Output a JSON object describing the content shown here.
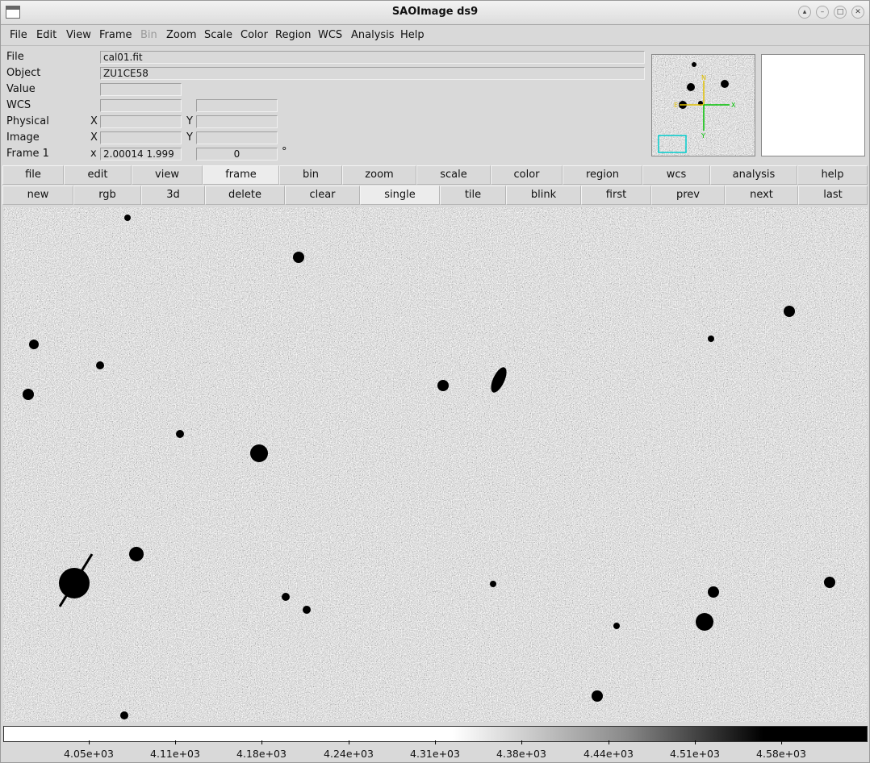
{
  "window": {
    "title": "SAOImage ds9"
  },
  "menubar": [
    "File",
    "Edit",
    "View",
    "Frame",
    "Bin",
    "Zoom",
    "Scale",
    "Color",
    "Region",
    "WCS",
    "Analysis",
    "Help"
  ],
  "menubar_disabled": [
    "Bin"
  ],
  "info": {
    "file_label": "File",
    "file_value": "cal01.fit",
    "object_label": "Object",
    "object_value": "ZU1CE58",
    "value_label": "Value",
    "value_value": "",
    "wcs_label": "WCS",
    "wcs_value_1": "",
    "wcs_value_2": "",
    "physical_label": "Physical",
    "physical_x_label": "X",
    "physical_y_label": "Y",
    "physical_x": "",
    "physical_y": "",
    "image_label": "Image",
    "image_x_label": "X",
    "image_y_label": "Y",
    "image_x": "",
    "image_y": "",
    "frame_label": "Frame 1",
    "frame_x_label": "x",
    "frame_zoom": "2.00014  1.999",
    "frame_angle": "0",
    "frame_angle_unit": "°"
  },
  "panner": {
    "compass_north": "N",
    "compass_east": "E",
    "compass_x": "X",
    "compass_y": "Y"
  },
  "buttonbar_main": [
    "file",
    "edit",
    "view",
    "frame",
    "bin",
    "zoom",
    "scale",
    "color",
    "region",
    "wcs",
    "analysis",
    "help"
  ],
  "buttonbar_main_active": "frame",
  "buttonbar_frame": [
    "new",
    "rgb",
    "3d",
    "delete",
    "clear",
    "single",
    "tile",
    "blink",
    "first",
    "prev",
    "next",
    "last"
  ],
  "buttonbar_frame_active": "single",
  "colorbar": {
    "colormap": "grey",
    "ticks": [
      "4.05e+03",
      "4.11e+03",
      "4.18e+03",
      "4.24e+03",
      "4.31e+03",
      "4.38e+03",
      "4.44e+03",
      "4.51e+03",
      "4.58e+03"
    ]
  },
  "colors": {
    "background": "#d9d9d9",
    "panner_box": "#00cccc",
    "compass_north": "#e0c000",
    "compass_x": "#00c000"
  }
}
